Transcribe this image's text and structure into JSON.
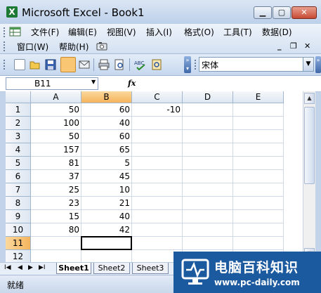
{
  "window": {
    "title": "Microsoft Excel - Book1"
  },
  "menu": {
    "items": [
      "文件(F)",
      "编辑(E)",
      "视图(V)",
      "插入(I)",
      "格式(O)",
      "工具(T)",
      "数据(D)",
      "窗口(W)",
      "帮助(H)"
    ]
  },
  "toolbar": {
    "font_name": "宋体"
  },
  "formula_bar": {
    "name_box": "B11",
    "fx_label": "fx",
    "formula": ""
  },
  "sheet": {
    "columns": [
      "A",
      "B",
      "C",
      "D",
      "E"
    ],
    "selected_column": "B",
    "rows": [
      {
        "n": "1",
        "A": "50",
        "B": "60",
        "C": "-10"
      },
      {
        "n": "2",
        "A": "100",
        "B": "40",
        "C": ""
      },
      {
        "n": "3",
        "A": "50",
        "B": "60",
        "C": ""
      },
      {
        "n": "4",
        "A": "157",
        "B": "65",
        "C": ""
      },
      {
        "n": "5",
        "A": "81",
        "B": "5",
        "C": ""
      },
      {
        "n": "6",
        "A": "37",
        "B": "45",
        "C": ""
      },
      {
        "n": "7",
        "A": "25",
        "B": "10",
        "C": ""
      },
      {
        "n": "8",
        "A": "23",
        "B": "21",
        "C": ""
      },
      {
        "n": "9",
        "A": "15",
        "B": "40",
        "C": ""
      },
      {
        "n": "10",
        "A": "80",
        "B": "42",
        "C": ""
      },
      {
        "n": "11",
        "A": "",
        "B": "",
        "C": ""
      },
      {
        "n": "12",
        "A": "",
        "B": "",
        "C": ""
      }
    ],
    "selected_row": "11",
    "active_cell": "B11"
  },
  "tabs": [
    "Sheet1",
    "Sheet2",
    "Sheet3"
  ],
  "status": "就绪",
  "watermark": {
    "name": "电脑百科知识",
    "url": "www.pc-daily.com"
  },
  "colors": {
    "selection_header": "#f5b45c",
    "title_bar": "#bcd0ea",
    "watermark_bg": "#1c5aa0"
  }
}
